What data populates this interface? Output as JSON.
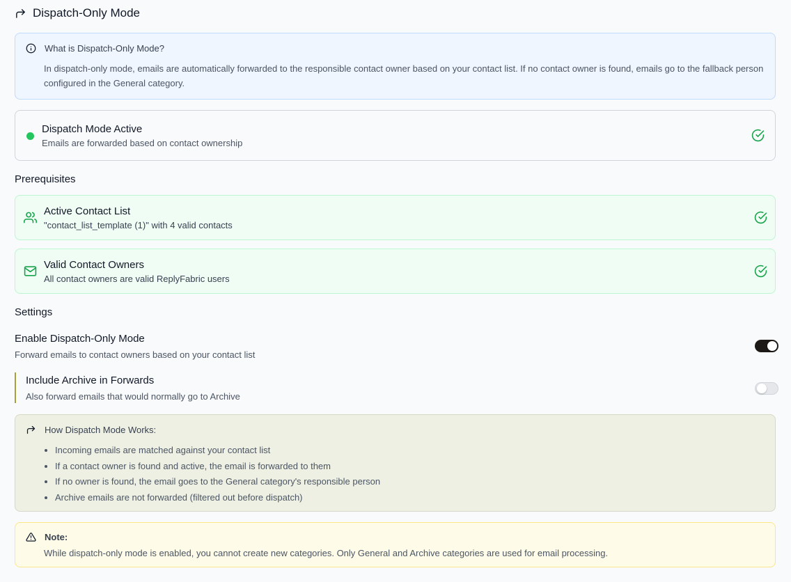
{
  "header": {
    "title": "Dispatch-Only Mode",
    "icon": "forward-arrow-icon"
  },
  "info": {
    "title": "What is Dispatch-Only Mode?",
    "body": "In dispatch-only mode, emails are automatically forwarded to the responsible contact owner based on your contact list. If no contact owner is found, emails go to the fallback person configured in the General category."
  },
  "status": {
    "title": "Dispatch Mode Active",
    "subtitle": "Emails are forwarded based on contact ownership",
    "color": "#22c55e"
  },
  "prerequisites": {
    "heading": "Prerequisites",
    "items": [
      {
        "title": "Active Contact List",
        "subtitle": "\"contact_list_template (1)\" with 4 valid contacts",
        "icon": "users-icon"
      },
      {
        "title": "Valid Contact Owners",
        "subtitle": "All contact owners are valid ReplyFabric users",
        "icon": "mail-icon"
      }
    ]
  },
  "settings": {
    "heading": "Settings",
    "enable": {
      "title": "Enable Dispatch-Only Mode",
      "subtitle": "Forward emails to contact owners based on your contact list",
      "enabled": true
    },
    "archive": {
      "title": "Include Archive in Forwards",
      "subtitle": "Also forward emails that would normally go to Archive",
      "enabled": false
    }
  },
  "how": {
    "title": "How Dispatch Mode Works:",
    "items": [
      "Incoming emails are matched against your contact list",
      "If a contact owner is found and active, the email is forwarded to them",
      "If no owner is found, the email goes to the General category's responsible person",
      "Archive emails are not forwarded (filtered out before dispatch)"
    ]
  },
  "note": {
    "title": "Note:",
    "body": "While dispatch-only mode is enabled, you cannot create new categories. Only General and Archive categories are used for email processing."
  }
}
